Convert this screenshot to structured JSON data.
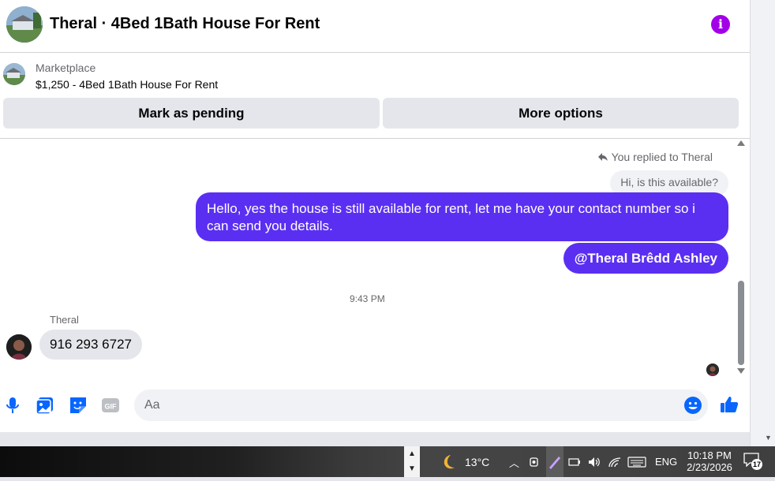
{
  "header": {
    "title": "Theral · 4Bed 1Bath House For Rent",
    "info_icon": "info-icon",
    "info_color": "#a200e8"
  },
  "listing": {
    "source": "Marketplace",
    "price_title": "$1,250 - 4Bed 1Bath House For Rent",
    "mark_pending_label": "Mark as pending",
    "more_options_label": "More options"
  },
  "chat": {
    "replied_label": "You replied to Theral",
    "quoted_text": "Hi, is this available?",
    "outgoing_message": "Hello, yes the house is still available for rent, let me have your contact number so i can send you details.",
    "mention_message": "@Theral Brêdd Ashley",
    "timestamp": "9:43 PM",
    "sender_name": "Theral",
    "incoming_message": "916 293 6727",
    "outgoing_color": "#5b2ff2"
  },
  "composer": {
    "placeholder": "Aa",
    "icons": [
      "microphone-icon",
      "photo-icon",
      "sticker-icon",
      "gif-icon",
      "emoji-icon",
      "thumbs-up-icon"
    ],
    "accent": "#0866ff"
  },
  "taskbar": {
    "temperature": "13°C",
    "language": "ENG",
    "time": "10:18 PM",
    "date": "2/23/2026",
    "notification_count": "17"
  }
}
